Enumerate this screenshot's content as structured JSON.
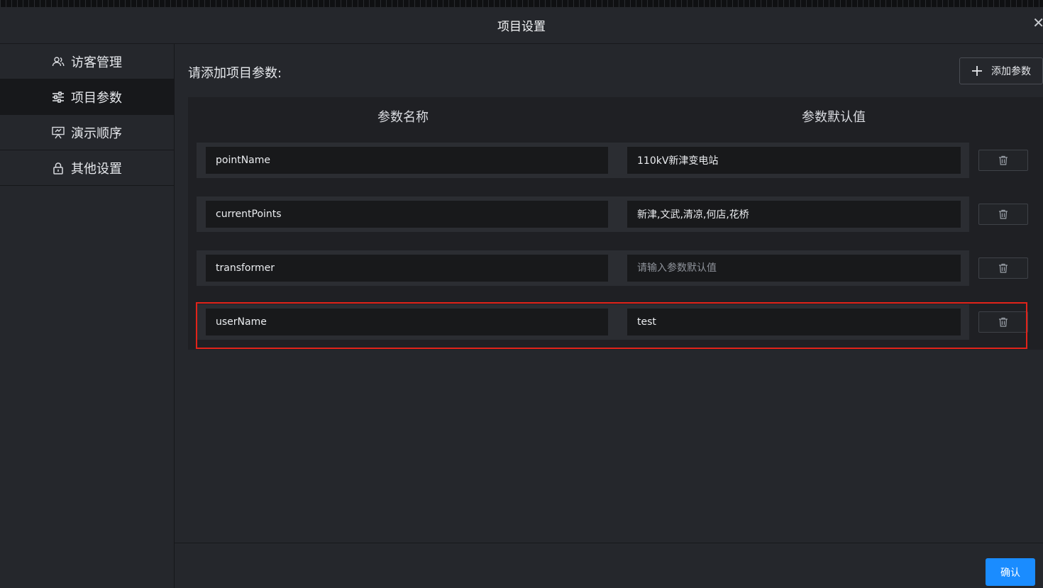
{
  "dialog": {
    "title": "项目设置"
  },
  "sidebar": {
    "items": [
      {
        "label": "访客管理",
        "icon": "users-icon"
      },
      {
        "label": "项目参数",
        "icon": "sliders-icon",
        "active": true
      },
      {
        "label": "演示顺序",
        "icon": "presentation-icon"
      },
      {
        "label": "其他设置",
        "icon": "lock-icon"
      }
    ]
  },
  "main": {
    "prompt": "请添加项目参数:",
    "add_button": "添加参数",
    "columns": {
      "name": "参数名称",
      "value": "参数默认值"
    },
    "value_placeholder": "请输入参数默认值",
    "rows": [
      {
        "name": "pointName",
        "value": "110kV新津变电站"
      },
      {
        "name": "currentPoints",
        "value": "新津,文武,清凉,何店,花桥"
      },
      {
        "name": "transformer",
        "value": ""
      },
      {
        "name": "userName",
        "value": "test"
      }
    ],
    "confirm_button": "确认"
  },
  "colors": {
    "accent": "#1a8cff",
    "highlight_border": "#e2231a"
  }
}
